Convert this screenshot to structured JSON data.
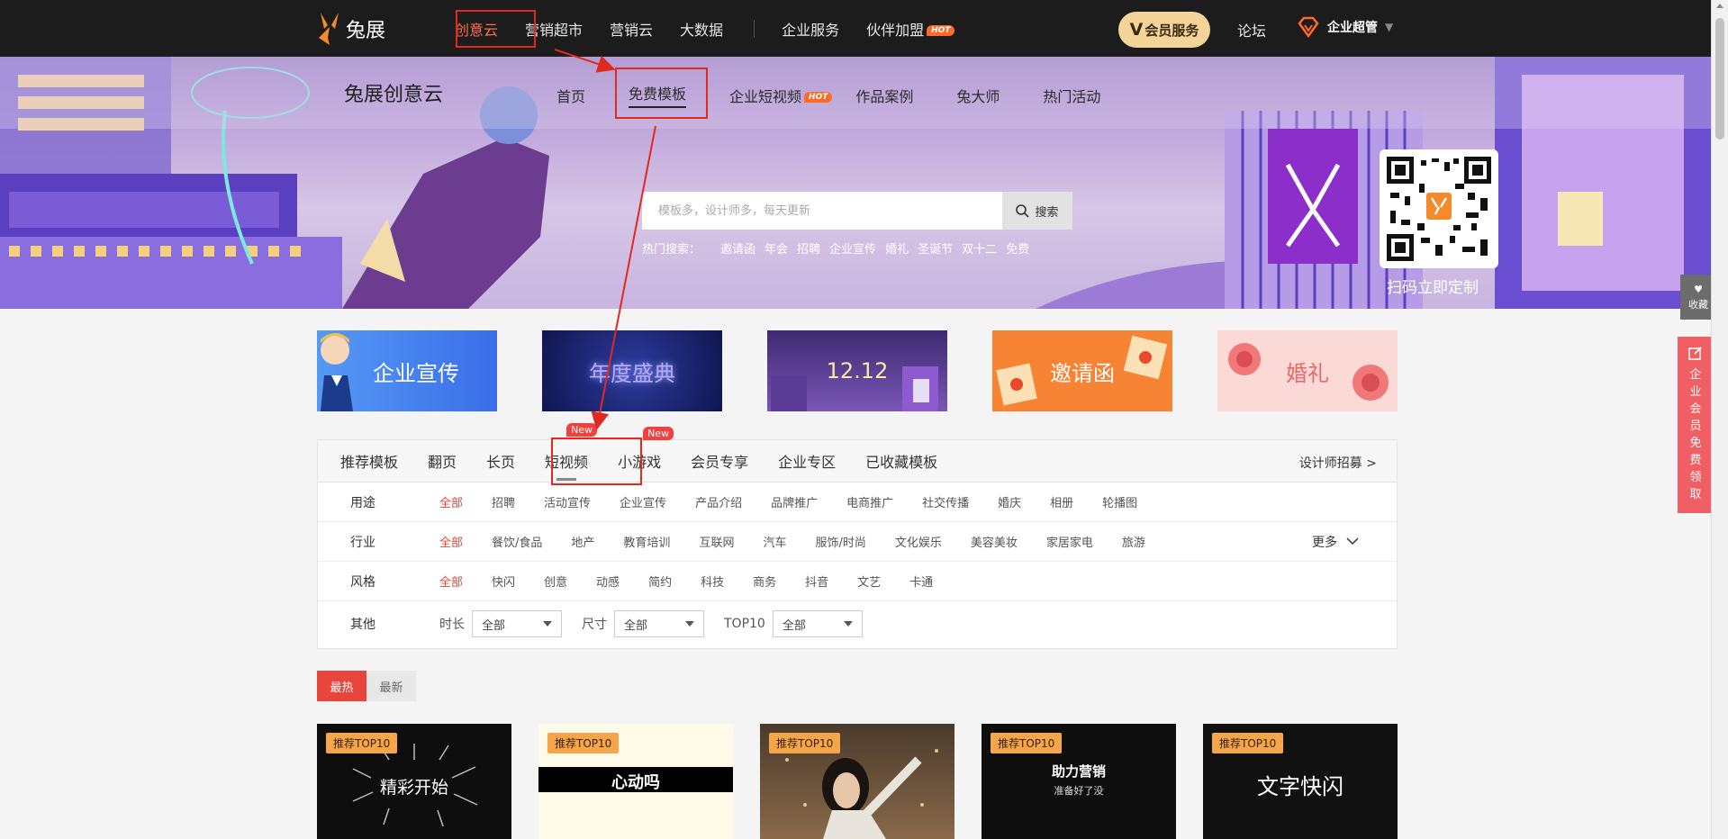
{
  "topnav": {
    "logo_text": "兔展",
    "items": [
      {
        "label": "创意云",
        "active": true
      },
      {
        "label": "营销超市"
      },
      {
        "label": "营销云"
      },
      {
        "label": "大数据"
      }
    ],
    "items_right": [
      {
        "label": "企业服务"
      },
      {
        "label": "伙伴加盟",
        "tag": "HOT"
      }
    ],
    "vip_v": "V",
    "vip_label": "会员服务",
    "forum": "论坛",
    "enterprise": "企业超管"
  },
  "banner": {
    "title": "兔展创意云",
    "subnav": [
      {
        "label": "首页"
      },
      {
        "label": "免费模板",
        "active": true
      },
      {
        "label": "企业短视频",
        "tag": "HOT"
      },
      {
        "label": "作品案例"
      },
      {
        "label": "兔大师"
      },
      {
        "label": "热门活动"
      }
    ],
    "search_placeholder": "模板多，设计师多，每天更新",
    "search_button": "搜索",
    "hot_label": "热门搜索：",
    "hot_terms": [
      "邀请函",
      "年会",
      "招聘",
      "企业宣传",
      "婚礼",
      "圣诞节",
      "双十二",
      "免费"
    ],
    "qr_caption": "扫码立即定制"
  },
  "categories": [
    {
      "label": "企业宣传",
      "color": "#3a7bea"
    },
    {
      "label": "年度盛典",
      "color": "#1c2466"
    },
    {
      "label": "12.12",
      "color": "#5a3a8a"
    },
    {
      "label": "邀请函",
      "color": "#f77a2a"
    },
    {
      "label": "婚礼",
      "color": "#f9d2cf"
    }
  ],
  "tabs": {
    "items": [
      {
        "label": "推荐模板"
      },
      {
        "label": "翻页"
      },
      {
        "label": "长页"
      },
      {
        "label": "短视频",
        "active": true,
        "tag": "New"
      },
      {
        "label": "小游戏",
        "tag": "New"
      },
      {
        "label": "会员专享"
      },
      {
        "label": "企业专区"
      },
      {
        "label": "已收藏模板"
      }
    ],
    "recruit": "设计师招募 >"
  },
  "filters": {
    "usage": {
      "label": "用途",
      "options": [
        "全部",
        "招聘",
        "活动宣传",
        "企业宣传",
        "产品介绍",
        "品牌推广",
        "电商推广",
        "社交传播",
        "婚庆",
        "相册",
        "轮播图"
      ]
    },
    "industry": {
      "label": "行业",
      "options": [
        "全部",
        "餐饮/食品",
        "地产",
        "教育培训",
        "互联网",
        "汽车",
        "服饰/时尚",
        "文化娱乐",
        "美容美妆",
        "家居家电",
        "旅游"
      ],
      "more": "更多"
    },
    "style": {
      "label": "风格",
      "options": [
        "全部",
        "快闪",
        "创意",
        "动感",
        "简约",
        "科技",
        "商务",
        "抖音",
        "文艺",
        "卡通"
      ]
    },
    "other": {
      "label": "其他",
      "duration_label": "时长",
      "duration_value": "全部",
      "size_label": "尺寸",
      "size_value": "全部",
      "top_label": "TOP10",
      "top_value": "全部"
    }
  },
  "sort": {
    "hot": "最热",
    "new": "最新"
  },
  "cards": [
    {
      "badge": "推荐TOP10",
      "title": "精彩开始"
    },
    {
      "badge": "推荐TOP10",
      "title": "心动吗"
    },
    {
      "badge": "推荐TOP10",
      "title": ""
    },
    {
      "badge": "推荐TOP10",
      "title": "助力营销",
      "subtitle": "准备好了没"
    },
    {
      "badge": "推荐TOP10",
      "title": "文字快闪"
    }
  ],
  "side": {
    "fav": "收藏",
    "enterprise_vertical": [
      "企",
      "业",
      "会",
      "员",
      "免",
      "费",
      "领",
      "取"
    ]
  },
  "colors": {
    "accent": "#e8453c",
    "highlight_box": "#e02a20",
    "vip_gold": "#f5d49a"
  }
}
